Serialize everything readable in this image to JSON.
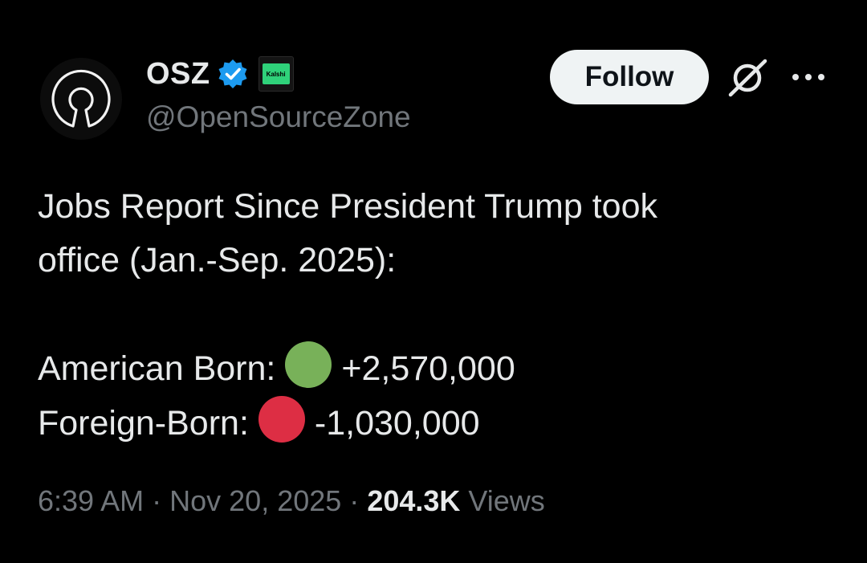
{
  "author": {
    "display_name": "OSZ",
    "handle": "@OpenSourceZone",
    "affiliate_label": "Kalshi",
    "verified_color": "#1d9bf0",
    "affiliate_color": "#2fd27a"
  },
  "actions": {
    "follow_label": "Follow",
    "grok_icon": "grok-icon",
    "more_icon": "more-options-icon"
  },
  "tweet": {
    "line1": "Jobs Report Since President Trump took",
    "line2": "office (Jan.-Sep. 2025):",
    "american_label": "American Born:",
    "american_value": "+2,570,000",
    "american_dot_color": "#78b159",
    "foreign_label": "Foreign-Born:",
    "foreign_value": "-1,030,000",
    "foreign_dot_color": "#dd2e44"
  },
  "meta": {
    "time": "6:39 AM",
    "separator": "·",
    "date": "Nov 20, 2025",
    "views_count": "204.3K",
    "views_label": "Views"
  }
}
